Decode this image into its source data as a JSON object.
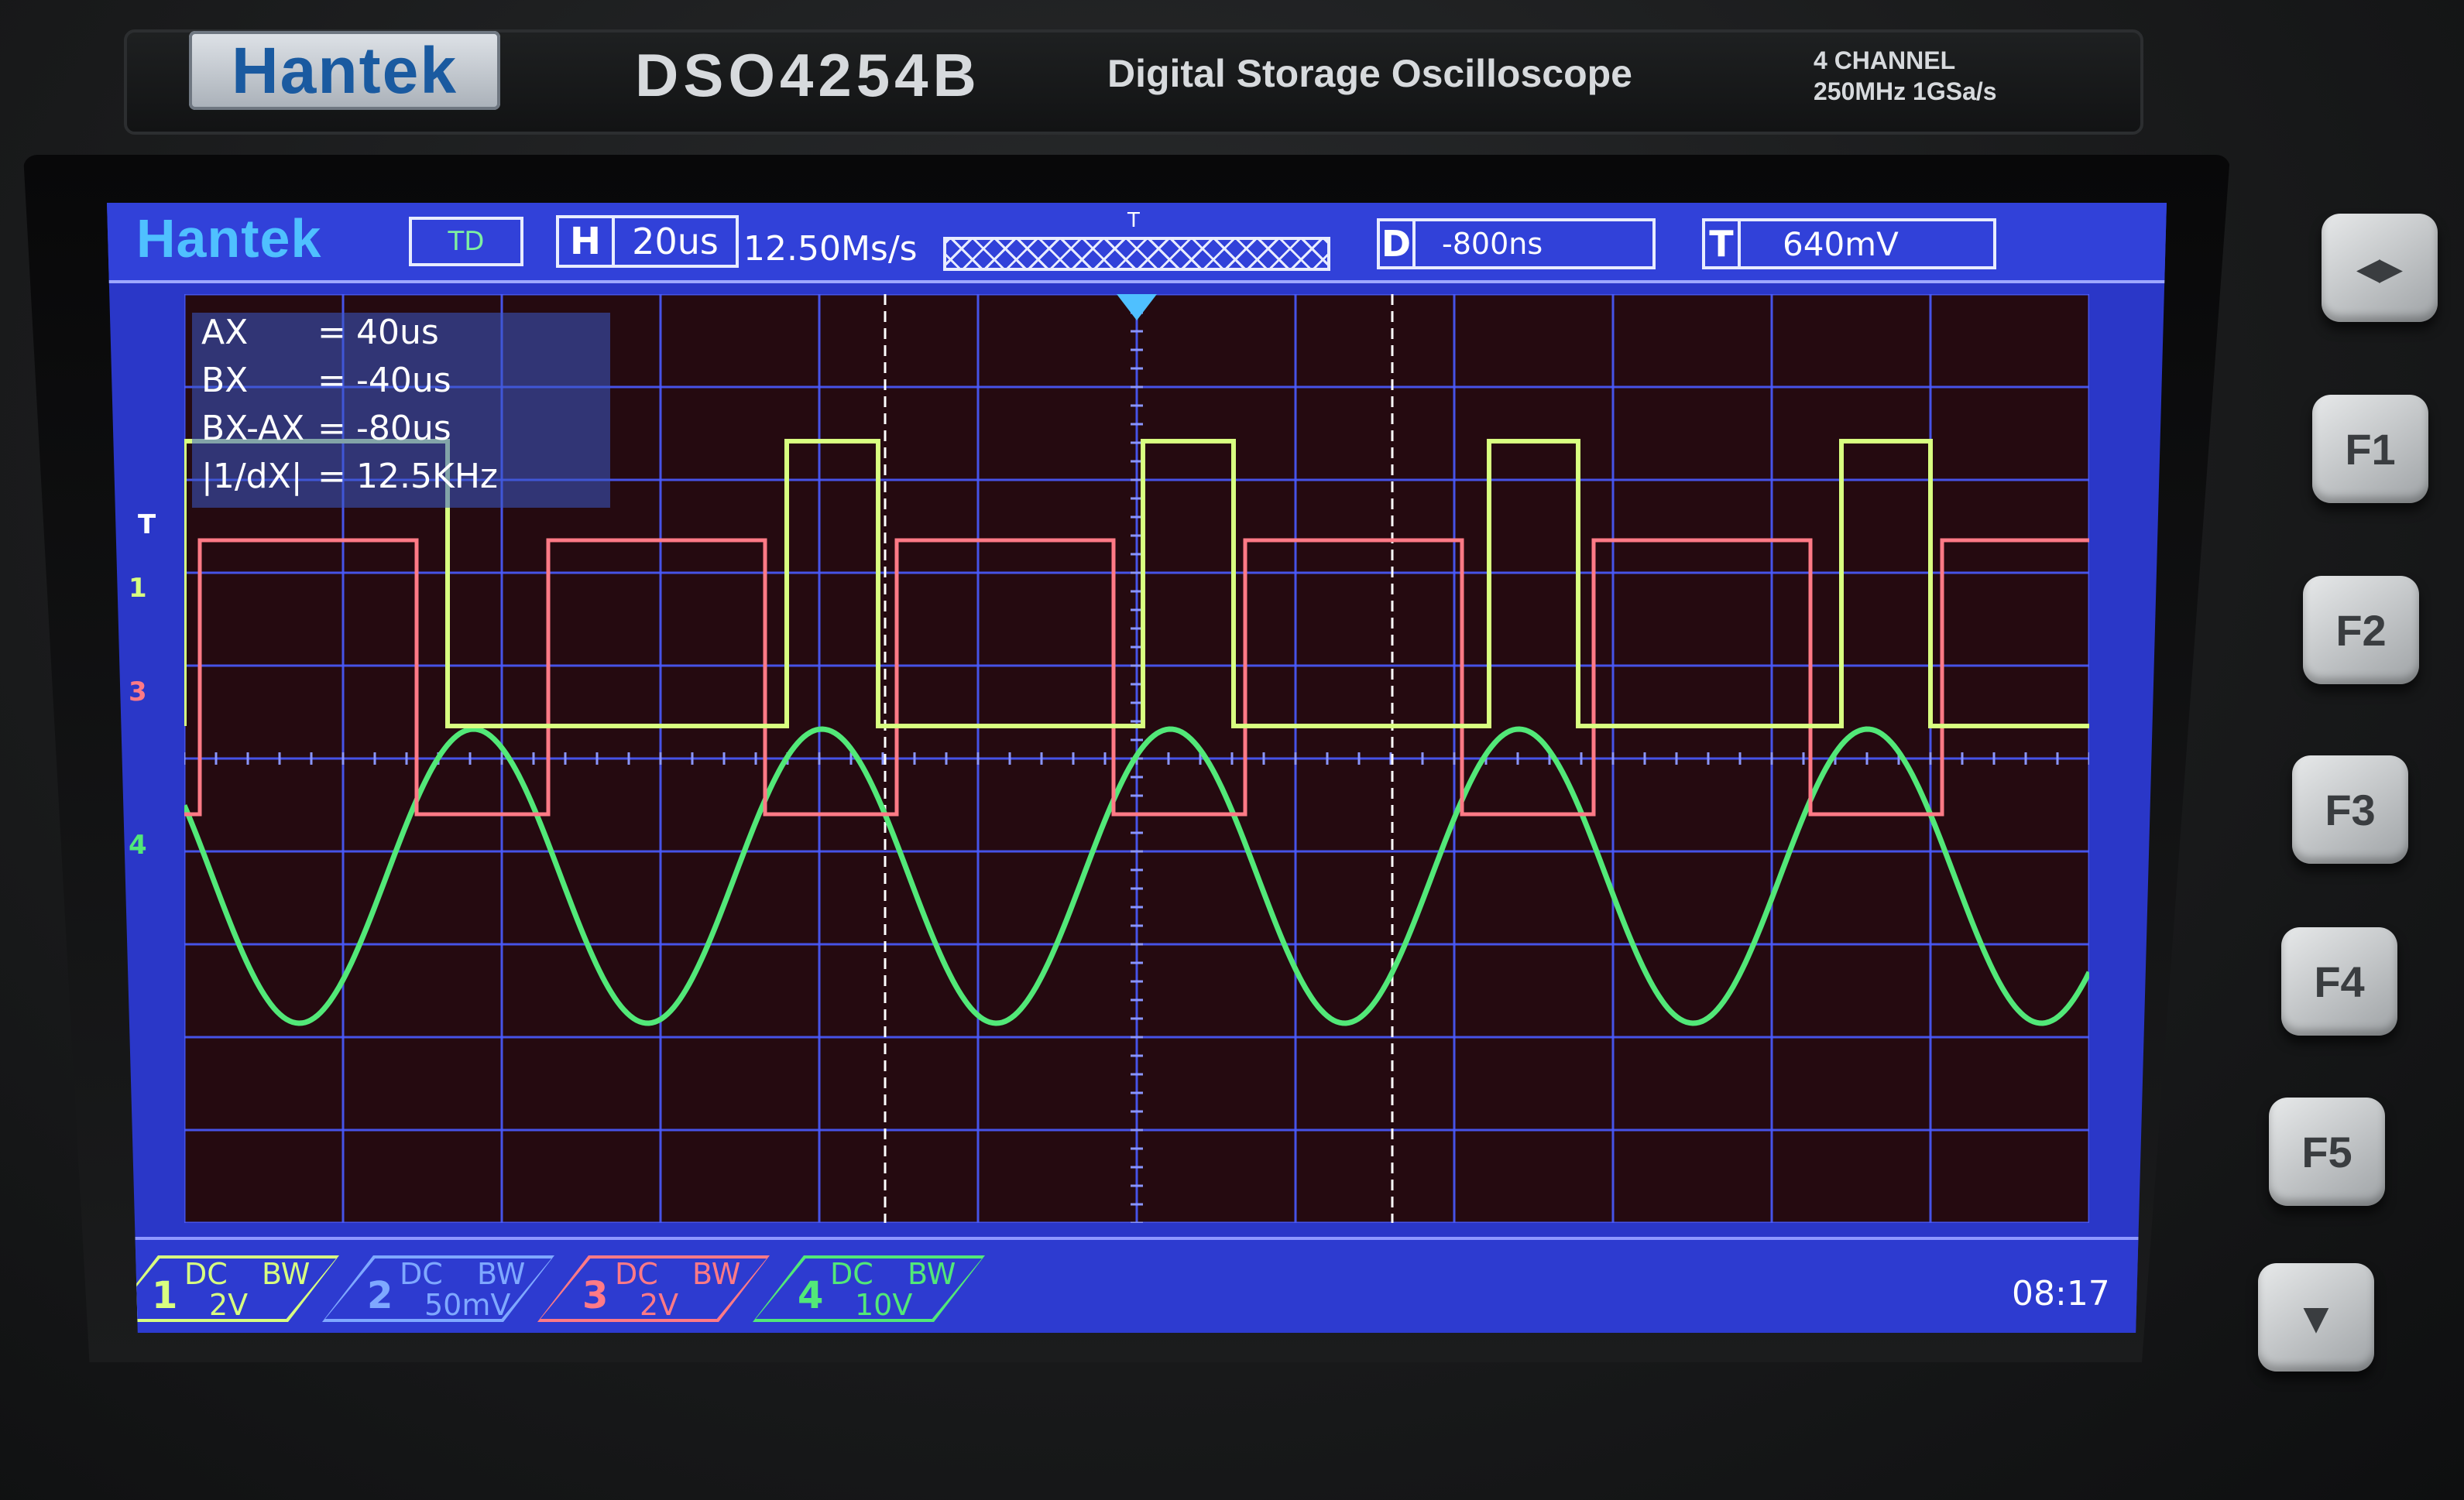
{
  "device": {
    "brand": "Hantek",
    "model": "DSO4254B",
    "subtitle": "Digital Storage Oscilloscope",
    "spec_line1": "4 CHANNEL",
    "spec_line2": "250MHz 1GSa/s"
  },
  "status": {
    "logo": "Hantek",
    "mode": "TD",
    "h_label": "H",
    "timebase": "20us",
    "sample_rate": "12.50Ms/s",
    "trigger_pointer": "T",
    "d_label": "D",
    "delay": "-800ns",
    "t_label": "T",
    "trigger_level": "640mV"
  },
  "cursors": {
    "rows": [
      {
        "key": "AX",
        "eq": "=",
        "val": "40us"
      },
      {
        "key": "BX",
        "eq": "=",
        "val": "-40us"
      },
      {
        "key": "BX-AX",
        "eq": "=",
        "val": "-80us"
      },
      {
        "key": "|1/dX|",
        "eq": "=",
        "val": "12.5KHz"
      }
    ]
  },
  "markers": {
    "trigger": "T",
    "ch1": "1",
    "ch3": "3",
    "ch4": "4"
  },
  "channels": [
    {
      "num": "1",
      "coupling": "DC",
      "bw": "BW",
      "scale": "2V",
      "color": "#d8ff80"
    },
    {
      "num": "2",
      "coupling": "DC",
      "bw": "BW",
      "scale": "50mV",
      "color": "#7fa8ff"
    },
    {
      "num": "3",
      "coupling": "DC",
      "bw": "BW",
      "scale": "2V",
      "color": "#ff7a86"
    },
    {
      "num": "4",
      "coupling": "DC",
      "bw": "BW",
      "scale": "10V",
      "color": "#52e878"
    }
  ],
  "clock": "08:17",
  "buttons": {
    "menu": "◂▸",
    "f1": "F1",
    "f2": "F2",
    "f3": "F3",
    "f4": "F4",
    "f5": "F5",
    "down": "▼"
  },
  "colors": {
    "screen_bg": "#2a37c8",
    "plot_bg": "#250a10",
    "grid": "#4a5cff",
    "ch1": "#d8ff80",
    "ch3": "#ff7a86",
    "ch4": "#52e878"
  }
}
